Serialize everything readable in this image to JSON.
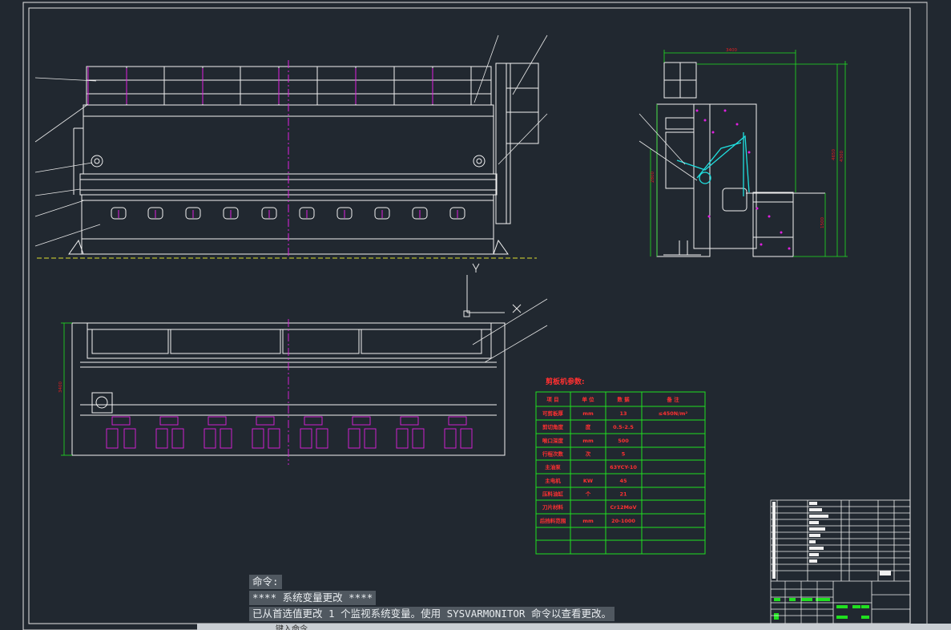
{
  "command_window": {
    "lines": [
      "命令:",
      "**** 系统变量更改 ****",
      "已从首选值更改 1 个监视系统变量。使用 SYSVARMONITOR 命令以查看更改。"
    ],
    "input_placeholder": "键入命令"
  },
  "drawing": {
    "background": "#212830",
    "axis_label": "Y",
    "side_view_dimension_top": "3400",
    "front_view_dimension_left": "3400",
    "side_view_dims_right": [
      "4650",
      "4300"
    ],
    "side_view_dim_left": "2800",
    "side_view_dim_low": "1500"
  },
  "param_table": {
    "title": "剪板机参数:",
    "header": [
      "项 目",
      "单 位",
      "数 据",
      "备 注"
    ],
    "rows": [
      [
        "可剪板厚",
        "mm",
        "13",
        "≤450N/m²"
      ],
      [
        "剪切角度",
        "度",
        "0.5-2.5",
        ""
      ],
      [
        "喉口深度",
        "mm",
        "500",
        ""
      ],
      [
        "行程次数",
        "次",
        "5",
        ""
      ],
      [
        "主油泵",
        "",
        "63YCY-10",
        ""
      ],
      [
        "主电机",
        "KW",
        "45",
        ""
      ],
      [
        "压料油缸",
        "个",
        "21",
        ""
      ],
      [
        "刀片材料",
        "",
        "Cr12MoV",
        ""
      ],
      [
        "后挡料范围",
        "mm",
        "20-1000",
        ""
      ],
      [
        "",
        "",
        "",
        ""
      ],
      [
        "",
        "",
        "",
        ""
      ]
    ]
  }
}
